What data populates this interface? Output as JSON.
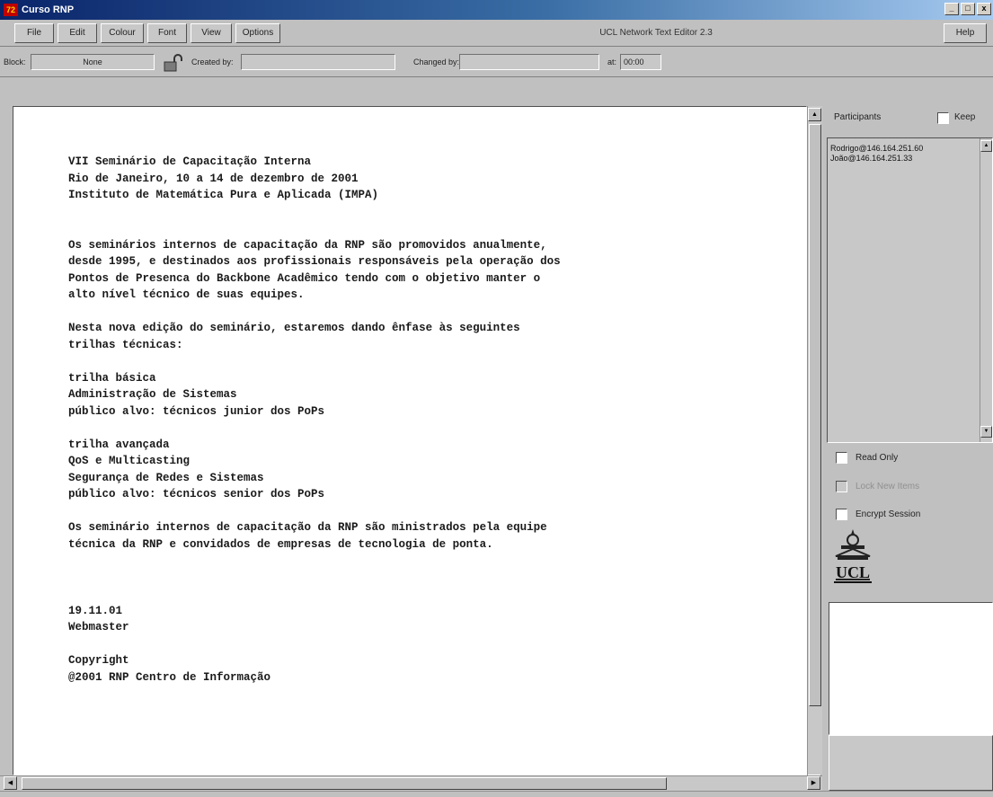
{
  "window": {
    "icon_text": "72",
    "title": "Curso RNP",
    "minimize": "_",
    "maximize": "□",
    "close": "x"
  },
  "menu": {
    "items": [
      "File",
      "Edit",
      "Colour",
      "Font",
      "View",
      "Options"
    ],
    "app_title": "UCL Network Text Editor 2.3",
    "help": "Help"
  },
  "toolbar": {
    "block_label": "Block:",
    "block_value": "None",
    "created_label": "Created by:",
    "created_value": "",
    "changed_label": "Changed by:",
    "changed_value": "",
    "at_label": "at:",
    "at_value": "00:00"
  },
  "document": {
    "lines": [
      "VII Seminário de Capacitação Interna",
      "Rio de Janeiro, 10 a 14 de dezembro de 2001",
      "Instituto de Matemática Pura e Aplicada (IMPA)",
      "",
      "",
      "Os seminários internos de capacitação da RNP são promovidos anualmente,",
      "desde 1995, e destinados aos profissionais responsáveis pela operação dos",
      "Pontos de Presenca do Backbone Acadêmico tendo com o objetivo manter o",
      "alto nível técnico de suas equipes.",
      "",
      "Nesta nova edição do seminário, estaremos dando ênfase às seguintes",
      "trilhas técnicas:",
      "",
      "trilha básica",
      "Administração de Sistemas",
      "público alvo: técnicos junior dos PoPs",
      "",
      "trilha avançada",
      "QoS e Multicasting",
      "Segurança de Redes e Sistemas",
      "público alvo: técnicos senior dos PoPs",
      "",
      "Os seminário internos de capacitação da RNP são ministrados pela equipe",
      "técnica da RNP e convidados de empresas de tecnologia de ponta.",
      "",
      "",
      "",
      "19.11.01",
      "Webmaster",
      "",
      "Copyright",
      "@2001 RNP Centro de Informação"
    ]
  },
  "sidebar": {
    "participants_label": "Participants",
    "keep_label": "Keep",
    "participants": [
      "Rodrigo@146.164.251.60",
      "João@146.164.251.33"
    ],
    "read_only_label": "Read Only",
    "lock_new_items_label": "Lock New Items",
    "encrypt_session_label": "Encrypt Session",
    "logo_text": "UCL"
  }
}
